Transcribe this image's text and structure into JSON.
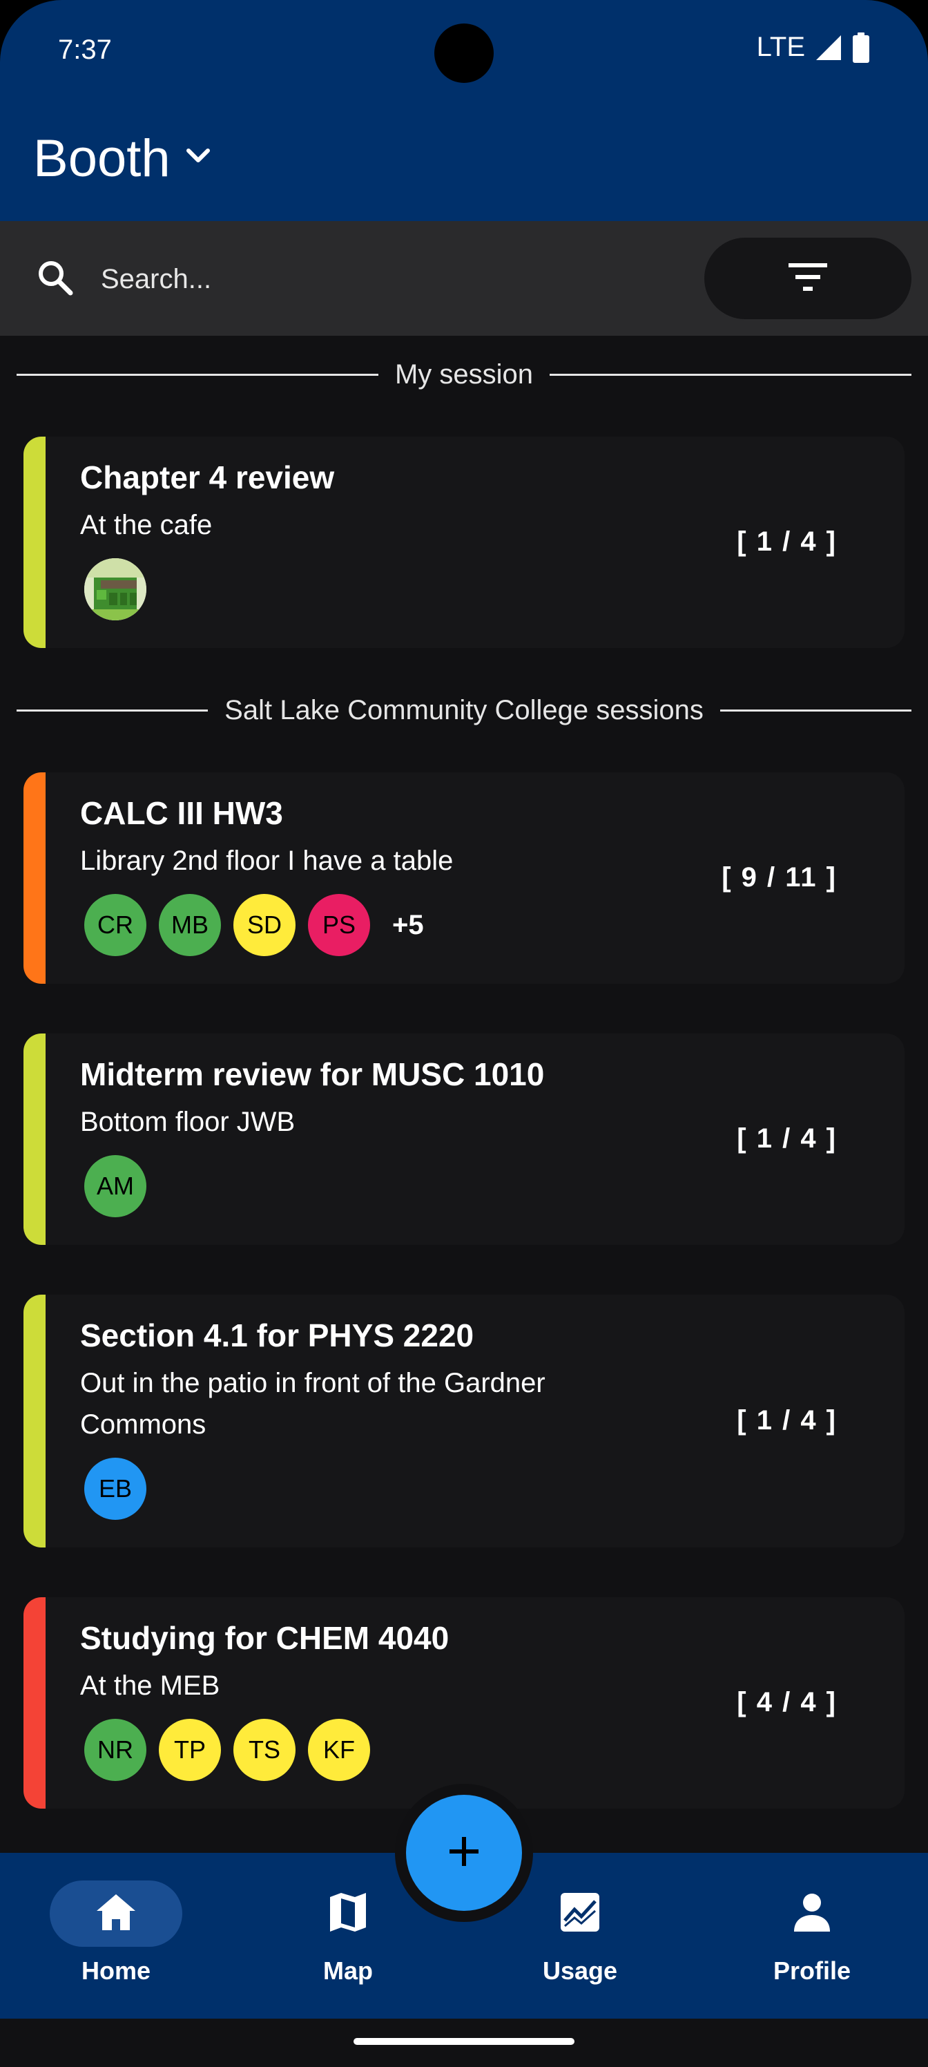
{
  "status_bar": {
    "time": "7:37",
    "network": "LTE"
  },
  "header": {
    "title": "Booth"
  },
  "search": {
    "placeholder": "Search..."
  },
  "sections": {
    "my_session": "My session",
    "college_sessions": "Salt Lake Community College sessions"
  },
  "my_sessions": [
    {
      "title": "Chapter 4 review",
      "location": "At the cafe",
      "count": "[ 1 / 4 ]",
      "accent": "#cddc39",
      "avatar": "pixel-art-avatar"
    }
  ],
  "college_sessions": [
    {
      "title": "CALC III HW3",
      "location": "Library 2nd floor I have a table",
      "count": "[ 9 / 11 ]",
      "accent": "#ff7518",
      "avatars": [
        {
          "initials": "CR",
          "color": "#4caf50"
        },
        {
          "initials": "MB",
          "color": "#4caf50"
        },
        {
          "initials": "SD",
          "color": "#ffeb3b"
        },
        {
          "initials": "PS",
          "color": "#e91e63"
        }
      ],
      "more": "+5"
    },
    {
      "title": "Midterm review for MUSC 1010",
      "location": "Bottom floor JWB",
      "count": "[ 1 / 4 ]",
      "accent": "#cddc39",
      "avatars": [
        {
          "initials": "AM",
          "color": "#4caf50"
        }
      ]
    },
    {
      "title": "Section 4.1 for PHYS 2220",
      "location": "Out in the patio in front of the Gardner Commons",
      "count": "[ 1 / 4 ]",
      "accent": "#cddc39",
      "avatars": [
        {
          "initials": "EB",
          "color": "#2196f3"
        }
      ]
    },
    {
      "title": "Studying for CHEM 4040",
      "location": "At the MEB",
      "count": "[ 4 / 4 ]",
      "accent": "#f44336",
      "avatars": [
        {
          "initials": "NR",
          "color": "#4caf50"
        },
        {
          "initials": "TP",
          "color": "#ffeb3b"
        },
        {
          "initials": "TS",
          "color": "#ffeb3b"
        },
        {
          "initials": "KF",
          "color": "#ffeb3b"
        }
      ]
    }
  ],
  "bottom_nav": {
    "items": [
      {
        "label": "Home",
        "icon": "home-icon",
        "active": true
      },
      {
        "label": "Map",
        "icon": "map-icon"
      },
      {
        "label": "Usage",
        "icon": "usage-chart-icon"
      },
      {
        "label": "Profile",
        "icon": "person-icon"
      }
    ]
  },
  "colors": {
    "app_bar": "#00306b",
    "background": "#111113",
    "card": "#161618",
    "fab": "#2196f3",
    "nav_active_pill": "#1a4e92"
  }
}
